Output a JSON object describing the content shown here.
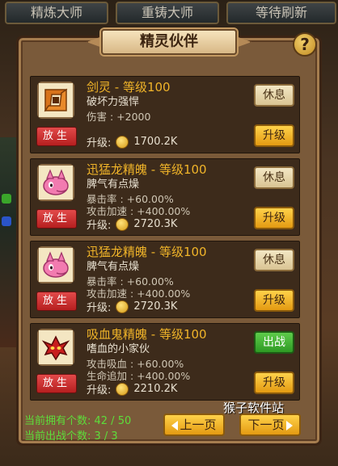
{
  "top_tabs": [
    "精炼大师",
    "重铸大师",
    "等待刷新"
  ],
  "title": "精灵伙伴",
  "help_label": "?",
  "release_label": "放生",
  "upgrade_prefix": "升级:",
  "cards": [
    {
      "name": "剑灵 - 等级100",
      "desc": "破坏力强悍",
      "stats": [
        "伤害 : +2000"
      ],
      "upgrade_cost": "1700.2K",
      "status_label": "休息",
      "status": "rest",
      "upgrade_label": "升级",
      "icon": "sword-spirit-icon"
    },
    {
      "name": "迅猛龙精魄 - 等级100",
      "desc": "脾气有点燥",
      "stats": [
        "暴击率 : +60.00%",
        "攻击加速 : +400.00%"
      ],
      "upgrade_cost": "2720.3K",
      "status_label": "休息",
      "status": "rest",
      "upgrade_label": "升级",
      "icon": "raptor-spirit-icon"
    },
    {
      "name": "迅猛龙精魄 - 等级100",
      "desc": "脾气有点燥",
      "stats": [
        "暴击率 : +60.00%",
        "攻击加速 : +400.00%"
      ],
      "upgrade_cost": "2720.3K",
      "status_label": "休息",
      "status": "rest",
      "upgrade_label": "升级",
      "icon": "raptor-spirit-icon"
    },
    {
      "name": "吸血鬼精魄 - 等级100",
      "desc": "嗜血的小家伙",
      "stats": [
        "攻击吸血 : +60.00%",
        "生命追加 : +400.00%"
      ],
      "upgrade_cost": "2210.2K",
      "status_label": "出战",
      "status": "battle",
      "upgrade_label": "升级",
      "icon": "vampire-spirit-icon"
    }
  ],
  "footer": {
    "owned": "当前拥有个数: 42 / 50",
    "active": "当前出战个数: 3 / 3",
    "prev_label": "上一页",
    "next_label": "下一页"
  },
  "watermark": "猴子软件站",
  "colors": {
    "panel": "#7a5a3a",
    "card": "#3d2b1b",
    "name": "#f0b429",
    "release": "#d02e2e",
    "battle": "#3aad2e",
    "upgrade": "#f0b429",
    "footer_text": "#5dde3a"
  }
}
